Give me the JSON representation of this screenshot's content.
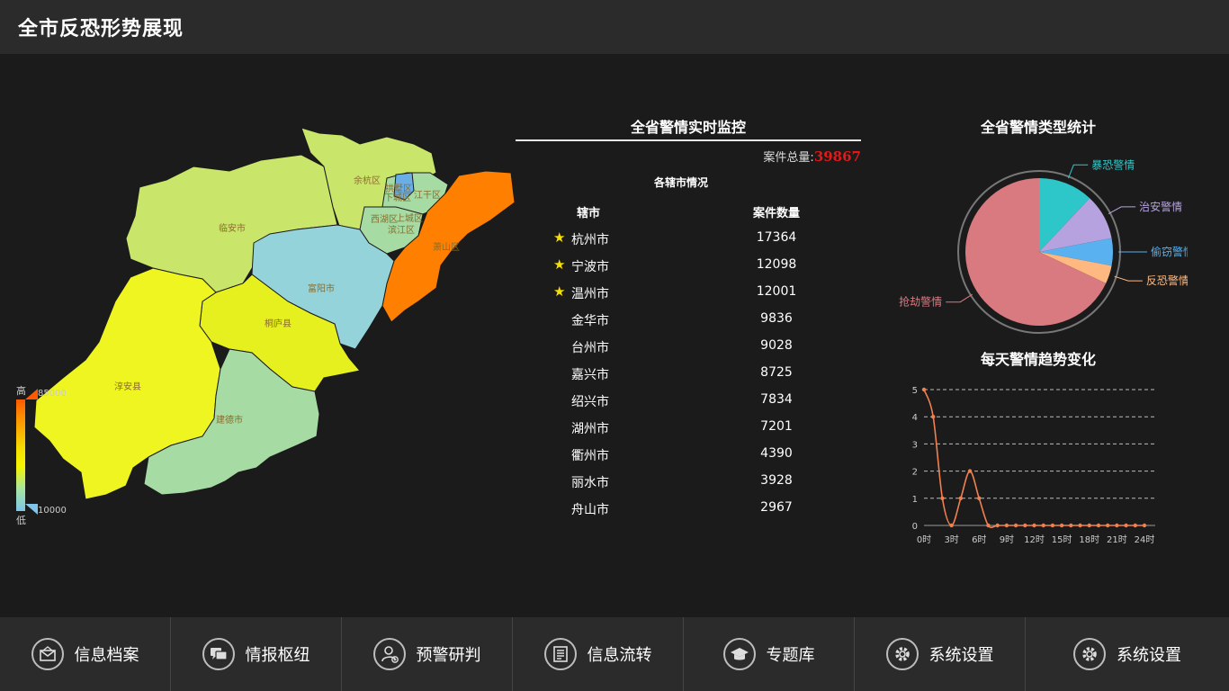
{
  "header": {
    "title": "全市反恐形势展现"
  },
  "map": {
    "regions": [
      {
        "name": "余杭区"
      },
      {
        "name": "拱墅区"
      },
      {
        "name": "下城区"
      },
      {
        "name": "江干区"
      },
      {
        "name": "西湖区"
      },
      {
        "name": "上城区"
      },
      {
        "name": "滨江区"
      },
      {
        "name": "萧山区"
      },
      {
        "name": "临安市"
      },
      {
        "name": "富阳市"
      },
      {
        "name": "桐庐县"
      },
      {
        "name": "淳安县"
      },
      {
        "name": "建德市"
      }
    ],
    "legend": {
      "high": "高",
      "low": "低",
      "max": "85000",
      "min": "10000"
    }
  },
  "monitor": {
    "title": "全省警情实时监控",
    "total_label": "案件总量:",
    "total_value": "39867",
    "subtitle": "各辖市情况",
    "col_city": "辖市",
    "col_count": "案件数量",
    "rows": [
      {
        "city": "杭州市",
        "count": "17364",
        "star": true
      },
      {
        "city": "宁波市",
        "count": "12098",
        "star": true
      },
      {
        "city": "温州市",
        "count": "12001",
        "star": true
      },
      {
        "city": "金华市",
        "count": "9836",
        "star": false
      },
      {
        "city": "台州市",
        "count": "9028",
        "star": false
      },
      {
        "city": "嘉兴市",
        "count": "8725",
        "star": false
      },
      {
        "city": "绍兴市",
        "count": "7834",
        "star": false
      },
      {
        "city": "湖州市",
        "count": "7201",
        "star": false
      },
      {
        "city": "衢州市",
        "count": "4390",
        "star": false
      },
      {
        "city": "丽水市",
        "count": "3928",
        "star": false
      },
      {
        "city": "舟山市",
        "count": "2967",
        "star": false
      }
    ]
  },
  "chart_data": [
    {
      "type": "pie",
      "title": "全省警情类型统计",
      "slices": [
        {
          "name": "暴恐警情",
          "value": 12,
          "color": "#2ec7c9"
        },
        {
          "name": "治安警情",
          "value": 10,
          "color": "#b6a2de"
        },
        {
          "name": "偷窃警情",
          "value": 6,
          "color": "#5ab1ef"
        },
        {
          "name": "反恐警情",
          "value": 4,
          "color": "#ffb980"
        },
        {
          "name": "抢劫警情",
          "value": 68,
          "color": "#d87a80"
        }
      ]
    },
    {
      "type": "line",
      "title": "每天警情趋势变化",
      "x": [
        "0时",
        "1时",
        "2时",
        "3时",
        "4时",
        "5时",
        "6时",
        "7时",
        "8时",
        "9时",
        "10时",
        "11时",
        "12时",
        "13时",
        "14时",
        "15时",
        "16时",
        "17时",
        "18时",
        "19时",
        "20时",
        "21时",
        "22时",
        "23时",
        "24时"
      ],
      "xtick_labels": [
        "0时",
        "3时",
        "6时",
        "9时",
        "12时",
        "15时",
        "18时",
        "21时",
        "24时"
      ],
      "series": [
        {
          "values": [
            5,
            4,
            1,
            0,
            1,
            2,
            1,
            0,
            0,
            0,
            0,
            0,
            0,
            0,
            0,
            0,
            0,
            0,
            0,
            0,
            0,
            0,
            0,
            0,
            0
          ],
          "color": "#f08050"
        }
      ],
      "ylim": [
        0,
        5
      ],
      "yticks": [
        "0",
        "1",
        "2",
        "3",
        "4",
        "5"
      ],
      "grid": true
    }
  ],
  "nav": {
    "items": [
      {
        "label": "信息档案",
        "icon": "mail-icon"
      },
      {
        "label": "情报枢纽",
        "icon": "chat-icon"
      },
      {
        "label": "预警研判",
        "icon": "user-add-icon"
      },
      {
        "label": "信息流转",
        "icon": "document-icon"
      },
      {
        "label": "专题库",
        "icon": "graduation-cap-icon"
      },
      {
        "label": "系统设置",
        "icon": "gear-icon"
      },
      {
        "label": "系统设置",
        "icon": "gear-icon"
      }
    ]
  }
}
